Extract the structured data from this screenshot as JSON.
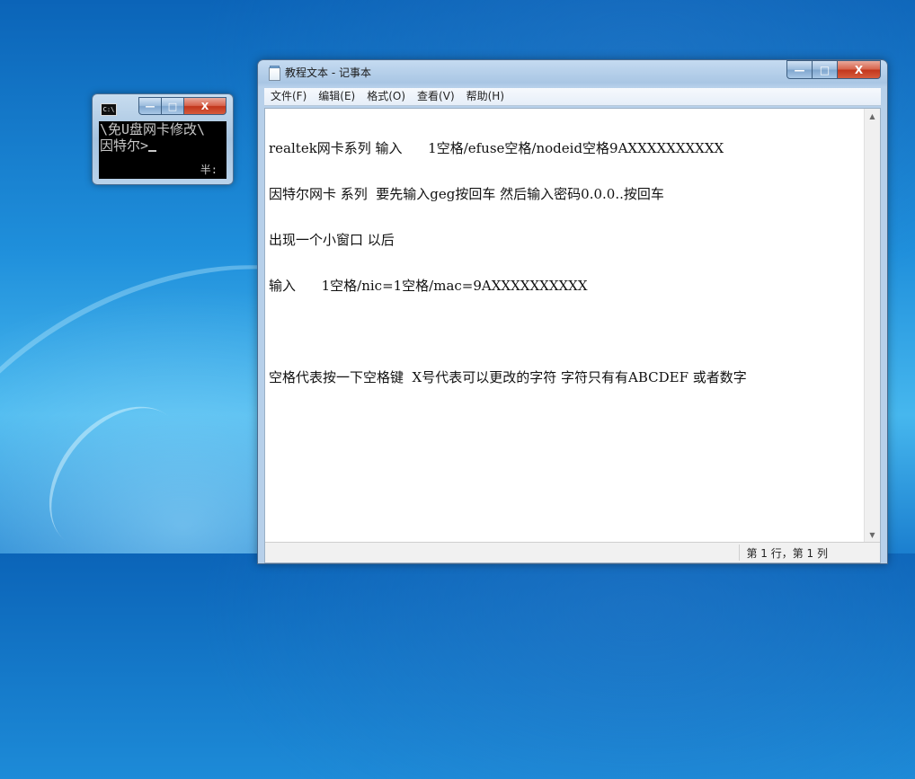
{
  "cmd": {
    "icon_label": "C:\\",
    "lines": [
      "\\免U盘网卡修改\\",
      "因特尔>"
    ],
    "ime": "半:",
    "controls": {
      "minimize": "—",
      "maximize": "□",
      "close": "X"
    }
  },
  "notepad": {
    "title": "教程文本 - 记事本",
    "controls": {
      "minimize": "—",
      "maximize": "□",
      "close": "X"
    },
    "menu": [
      "文件(F)",
      "编辑(E)",
      "格式(O)",
      "查看(V)",
      "帮助(H)"
    ],
    "lines": [
      "realtek网卡系列 输入      1空格/efuse空格/nodeid空格9AXXXXXXXXXX",
      "因特尔网卡 系列  要先输入geg按回车 然后输入密码0.0.0..按回车",
      "出现一个小窗口 以后",
      "输入      1空格/nic=1空格/mac=9AXXXXXXXXXX",
      "",
      "空格代表按一下空格键  X号代表可以更改的字符 字符只有有ABCDEF 或者数字"
    ],
    "status": "第 1 行，第 1 列",
    "scroll": {
      "up": "▲",
      "down": "▼"
    }
  }
}
